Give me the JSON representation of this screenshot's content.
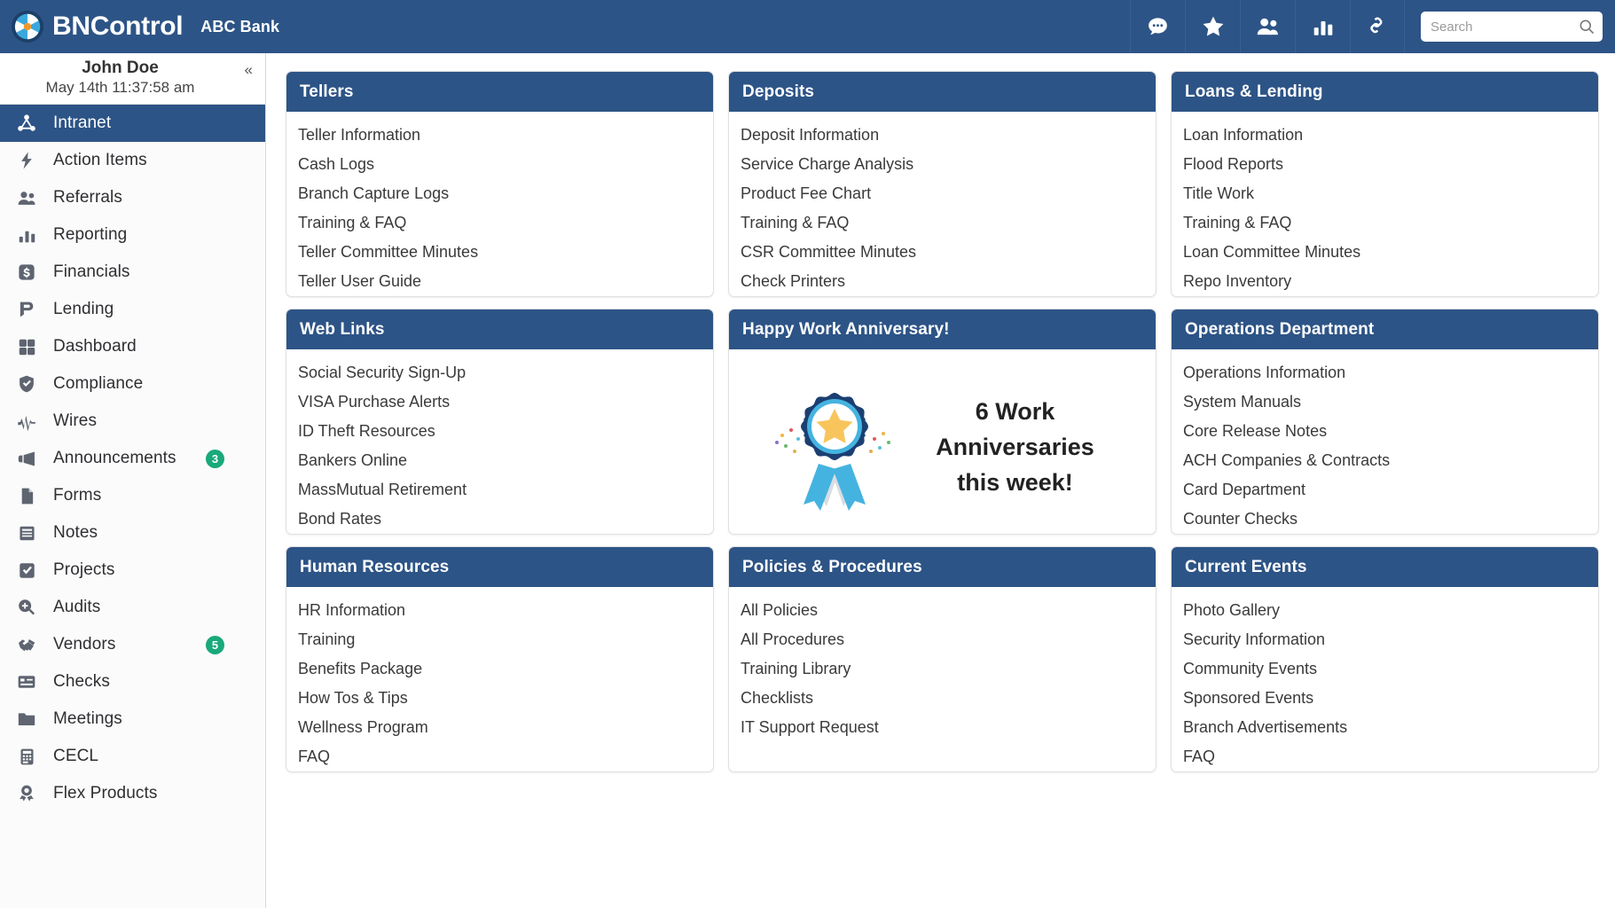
{
  "topbar": {
    "brand_name": "BNControl",
    "tenant_name": "ABC Bank",
    "logo_icon": "aperture-logo-icon",
    "icons": [
      {
        "name": "chat-icon",
        "label": "Chat"
      },
      {
        "name": "star-icon",
        "label": "Favorites"
      },
      {
        "name": "users-icon",
        "label": "Users"
      },
      {
        "name": "bar-chart-icon",
        "label": "Reports"
      },
      {
        "name": "link-icon",
        "label": "Links"
      }
    ],
    "search": {
      "placeholder": "Search",
      "value": "",
      "icon": "search-icon"
    }
  },
  "sidebar": {
    "user_name": "John Doe",
    "user_time": "May 14th 11:37:58 am",
    "collapse_label": "«",
    "items": [
      {
        "label": "Intranet",
        "icon": "network-icon",
        "active": true,
        "badge": ""
      },
      {
        "label": "Action Items",
        "icon": "bolt-icon",
        "active": false,
        "badge": ""
      },
      {
        "label": "Referrals",
        "icon": "people-icon",
        "active": false,
        "badge": ""
      },
      {
        "label": "Reporting",
        "icon": "bar-chart-icon",
        "active": false,
        "badge": ""
      },
      {
        "label": "Financials",
        "icon": "dollar-icon",
        "active": false,
        "badge": ""
      },
      {
        "label": "Lending",
        "icon": "lending-icon",
        "active": false,
        "badge": ""
      },
      {
        "label": "Dashboard",
        "icon": "grid-icon",
        "active": false,
        "badge": ""
      },
      {
        "label": "Compliance",
        "icon": "shield-check-icon",
        "active": false,
        "badge": ""
      },
      {
        "label": "Wires",
        "icon": "pulse-icon",
        "active": false,
        "badge": ""
      },
      {
        "label": "Announcements",
        "icon": "megaphone-icon",
        "active": false,
        "badge": "3"
      },
      {
        "label": "Forms",
        "icon": "document-icon",
        "active": false,
        "badge": ""
      },
      {
        "label": "Notes",
        "icon": "notes-icon",
        "active": false,
        "badge": ""
      },
      {
        "label": "Projects",
        "icon": "check-square-icon",
        "active": false,
        "badge": ""
      },
      {
        "label": "Audits",
        "icon": "magnifier-plus-icon",
        "active": false,
        "badge": ""
      },
      {
        "label": "Vendors",
        "icon": "handshake-icon",
        "active": false,
        "badge": "5"
      },
      {
        "label": "Checks",
        "icon": "check-card-icon",
        "active": false,
        "badge": ""
      },
      {
        "label": "Meetings",
        "icon": "folder-icon",
        "active": false,
        "badge": ""
      },
      {
        "label": "CECL",
        "icon": "calculator-icon",
        "active": false,
        "badge": ""
      },
      {
        "label": "Flex Products",
        "icon": "award-icon",
        "active": false,
        "badge": ""
      }
    ]
  },
  "main": {
    "cards": [
      {
        "title": "Tellers",
        "type": "links",
        "links": [
          "Teller Information",
          "Cash Logs",
          "Branch Capture Logs",
          "Training & FAQ",
          "Teller Committee Minutes",
          "Teller User Guide"
        ]
      },
      {
        "title": "Deposits",
        "type": "links",
        "links": [
          "Deposit Information",
          "Service Charge Analysis",
          "Product Fee Chart",
          "Training & FAQ",
          "CSR Committee Minutes",
          "Check Printers"
        ]
      },
      {
        "title": "Loans & Lending",
        "type": "links",
        "links": [
          "Loan Information",
          "Flood Reports",
          "Title Work",
          "Training & FAQ",
          "Loan Committee Minutes",
          "Repo Inventory"
        ]
      },
      {
        "title": "Web Links",
        "type": "links",
        "links": [
          "Social Security Sign-Up",
          "VISA Purchase Alerts",
          "ID Theft Resources",
          "Bankers Online",
          "MassMutual Retirement",
          "Bond Rates"
        ]
      },
      {
        "title": "Happy Work Anniversary!",
        "type": "anniversary",
        "image_icon": "award-ribbon-icon",
        "message": "6 Work Anniversaries this week!",
        "links": []
      },
      {
        "title": "Operations Department",
        "type": "links",
        "links": [
          "Operations Information",
          "System Manuals",
          "Core Release Notes",
          "ACH Companies & Contracts",
          "Card Department",
          "Counter Checks"
        ]
      },
      {
        "title": "Human Resources",
        "type": "links",
        "links": [
          "HR Information",
          "Training",
          "Benefits Package",
          "How Tos & Tips",
          "Wellness Program",
          "FAQ"
        ]
      },
      {
        "title": "Policies & Procedures",
        "type": "links",
        "links": [
          "All Policies",
          "All Procedures",
          "Training Library",
          "Checklists",
          "IT Support Request"
        ]
      },
      {
        "title": "Current Events",
        "type": "links",
        "links": [
          "Photo Gallery",
          "Security Information",
          "Community Events",
          "Sponsored Events",
          "Branch Advertisements",
          "FAQ"
        ]
      }
    ]
  },
  "colors": {
    "brand_blue": "#2d5486",
    "badge_green": "#19a97a",
    "logo_accent": "#f0992a",
    "ribbon_blue": "#1b3f72",
    "ribbon_light": "#45b3e0",
    "star_gold": "#f8c55c"
  }
}
